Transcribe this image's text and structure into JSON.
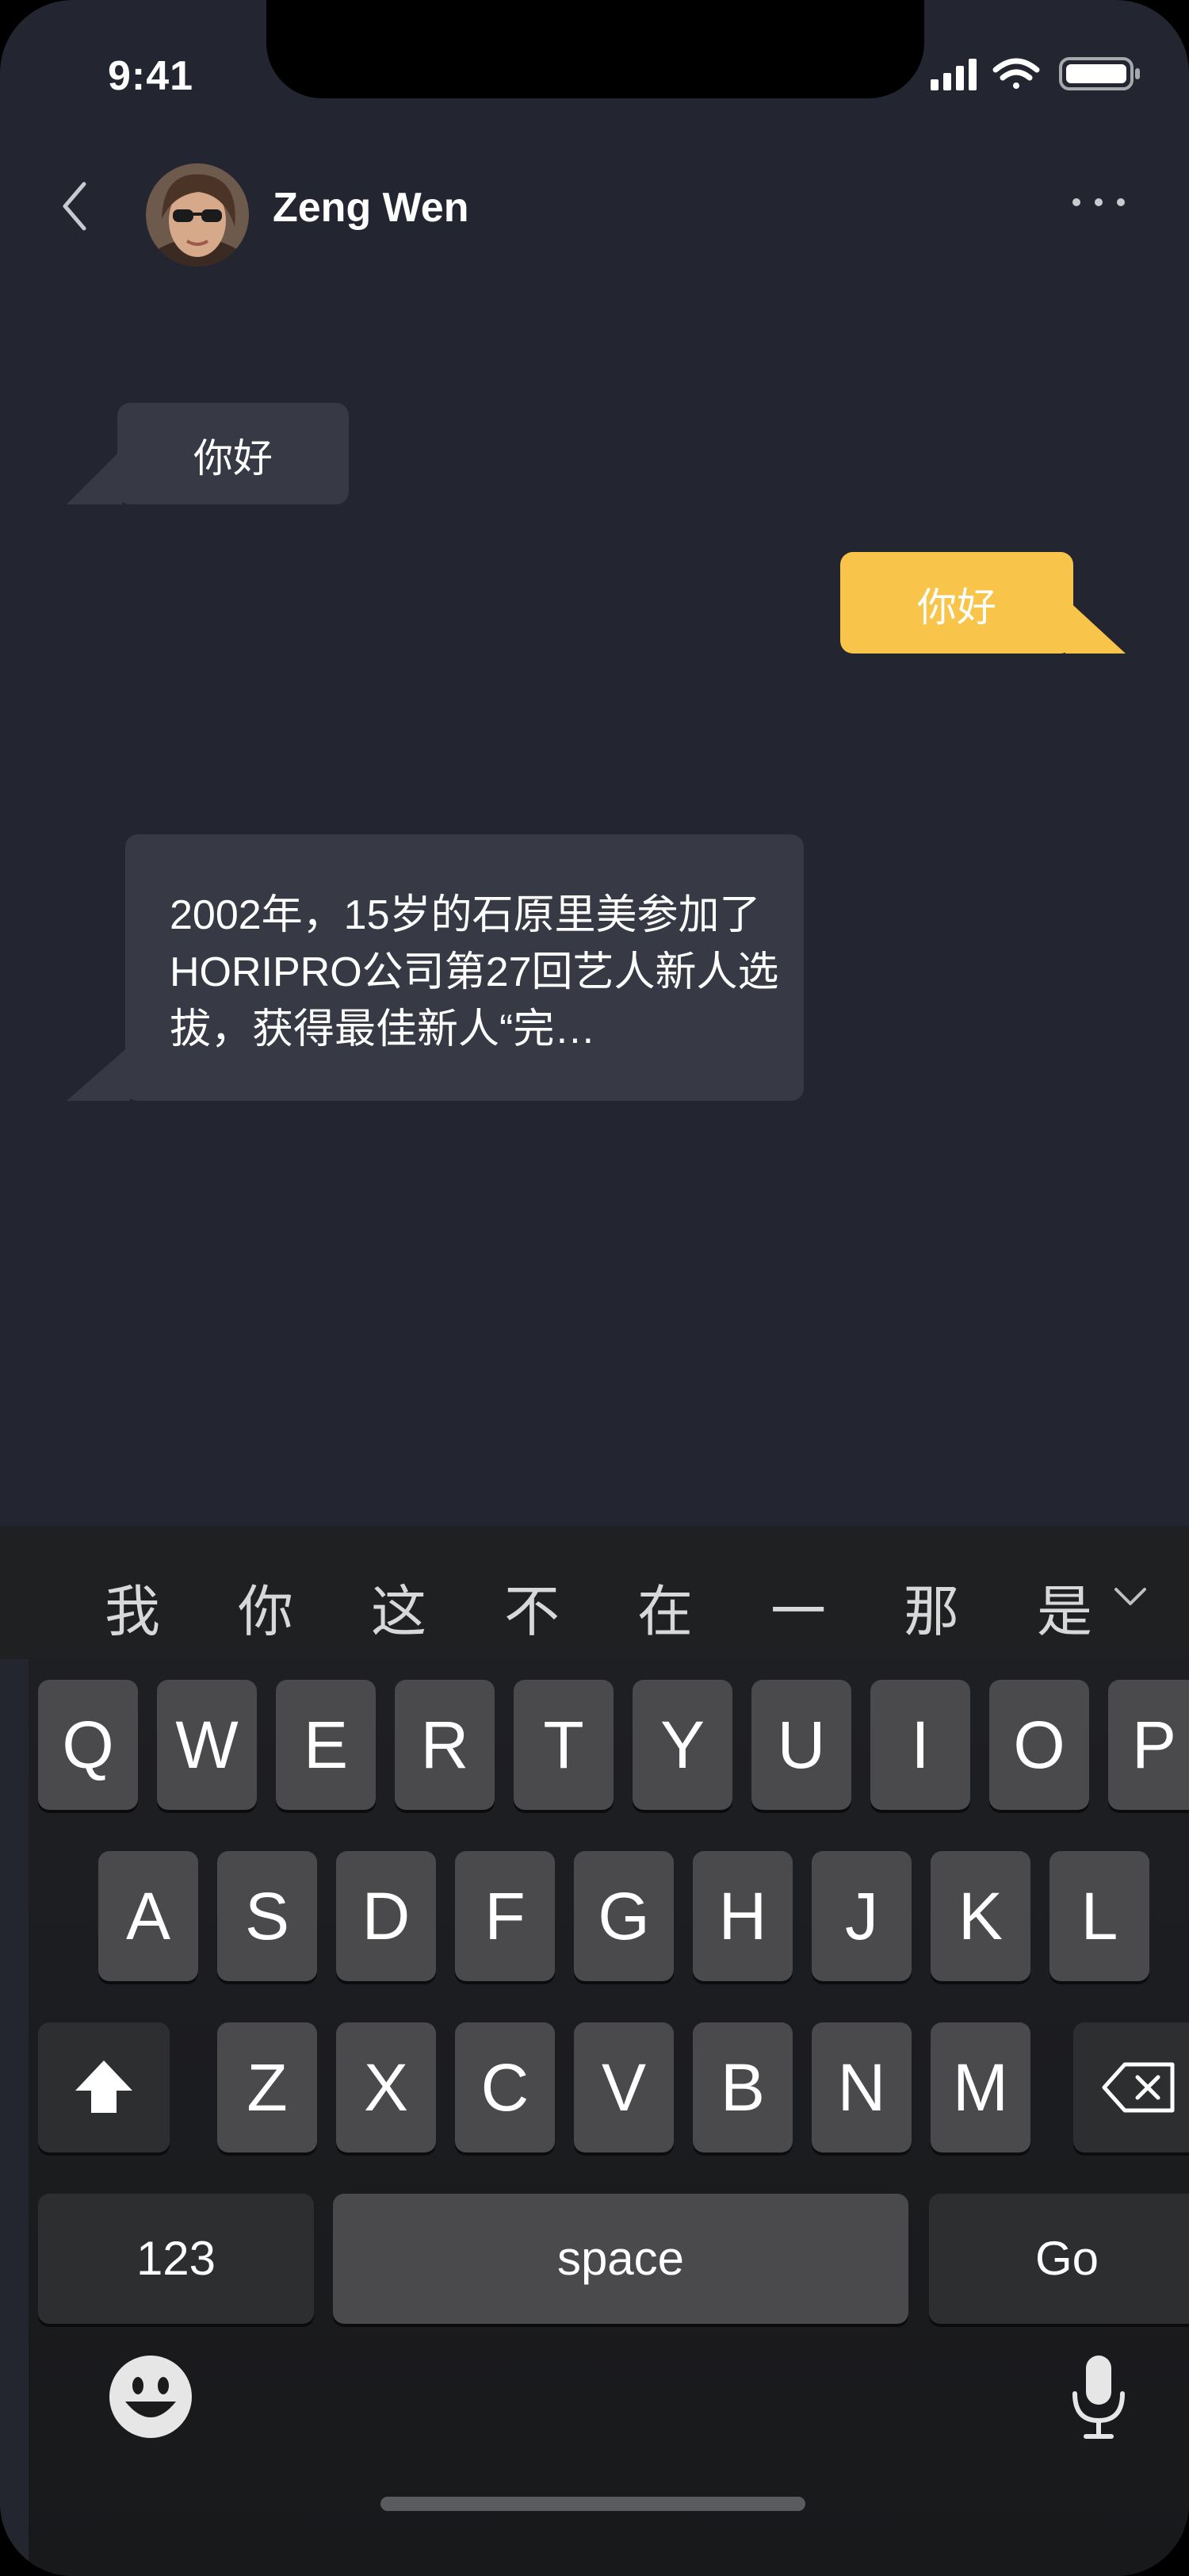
{
  "status_bar": {
    "time": "9:41"
  },
  "header": {
    "contact_name": "Zeng Wen"
  },
  "messages": [
    {
      "direction": "incoming",
      "text": "你好"
    },
    {
      "direction": "outgoing",
      "text": "你好"
    },
    {
      "direction": "incoming",
      "text": "2002年，15岁的石原里美参加了HORIPRO公司第27回艺人新人选拔，获得最佳新人“完…"
    }
  ],
  "keyboard": {
    "candidates": [
      "我",
      "你",
      "这",
      "不",
      "在",
      "一",
      "那",
      "是"
    ],
    "rows": [
      [
        "Q",
        "W",
        "E",
        "R",
        "T",
        "Y",
        "U",
        "I",
        "O",
        "P"
      ],
      [
        "A",
        "S",
        "D",
        "F",
        "G",
        "H",
        "J",
        "K",
        "L"
      ],
      [
        "Z",
        "X",
        "C",
        "V",
        "B",
        "N",
        "M"
      ]
    ],
    "numbers_key": "123",
    "space_key": "space",
    "go_key": "Go"
  },
  "colors": {
    "background": "#232630",
    "incoming_bubble": "#373a45",
    "outgoing_bubble": "#f8c44a"
  },
  "icons": [
    "back-chevron-icon",
    "more-icon",
    "shift-icon",
    "backspace-icon",
    "emoji-icon",
    "microphone-icon",
    "chevron-down-icon"
  ]
}
